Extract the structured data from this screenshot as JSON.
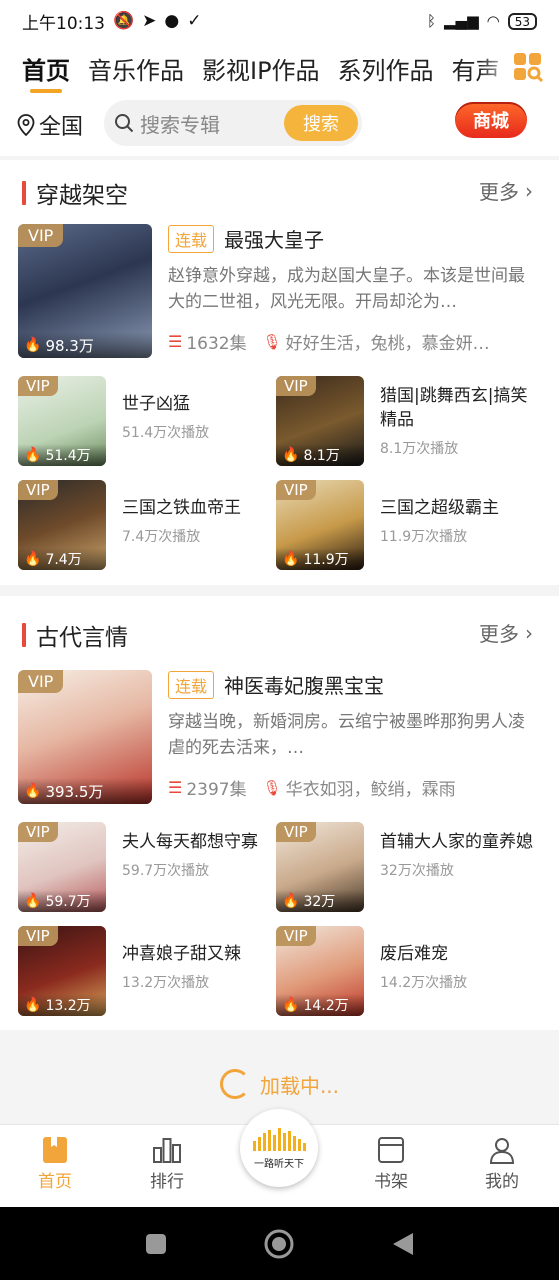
{
  "status_bar": {
    "time": "上午10:13",
    "battery": "53"
  },
  "tabs": [
    {
      "label": "首页",
      "active": true
    },
    {
      "label": "音乐作品"
    },
    {
      "label": "影视IP作品"
    },
    {
      "label": "系列作品"
    },
    {
      "label": "有声"
    }
  ],
  "search": {
    "location": "全国",
    "placeholder": "搜索专辑",
    "button": "搜索",
    "mall": "商城"
  },
  "sections": [
    {
      "title": "穿越架空",
      "more": "更多",
      "featured": {
        "vip": "VIP",
        "tag": "连载",
        "title": "最强大皇子",
        "desc": "赵铮意外穿越，成为赵国大皇子。本该是世间最大的二世祖，风光无限。开局却沦为…",
        "episodes": "1632集",
        "narrators": "好好生活，兔桃，慕金妍…",
        "plays": "98.3万"
      },
      "items": [
        {
          "vip": "VIP",
          "title": "世子凶猛",
          "sub": "51.4万次播放",
          "plays": "51.4万"
        },
        {
          "vip": "VIP",
          "title": "猎国|跳舞西玄|搞笑精品",
          "sub": "8.1万次播放",
          "plays": "8.1万"
        },
        {
          "vip": "VIP",
          "title": "三国之铁血帝王",
          "sub": "7.4万次播放",
          "plays": "7.4万"
        },
        {
          "vip": "VIP",
          "title": "三国之超级霸主",
          "sub": "11.9万次播放",
          "plays": "11.9万"
        }
      ]
    },
    {
      "title": "古代言情",
      "more": "更多",
      "featured": {
        "vip": "VIP",
        "tag": "连载",
        "title": "神医毒妃腹黑宝宝",
        "desc": "穿越当晚，新婚洞房。云绾宁被墨晔那狗男人凌虐的死去活来，…",
        "episodes": "2397集",
        "narrators": "华衣如羽，鲛绡，霖雨",
        "plays": "393.5万"
      },
      "items": [
        {
          "vip": "VIP",
          "title": "夫人每天都想守寡",
          "sub": "59.7万次播放",
          "plays": "59.7万"
        },
        {
          "vip": "VIP",
          "title": "首辅大人家的童养媳",
          "sub": "32万次播放",
          "plays": "32万"
        },
        {
          "vip": "VIP",
          "title": "冲喜娘子甜又辣",
          "sub": "13.2万次播放",
          "plays": "13.2万"
        },
        {
          "vip": "VIP",
          "title": "废后难宠",
          "sub": "14.2万次播放",
          "plays": "14.2万"
        }
      ]
    }
  ],
  "loading": "加载中...",
  "bottom_nav": [
    {
      "label": "首页",
      "active": true
    },
    {
      "label": "排行"
    },
    {
      "label": "书架"
    },
    {
      "label": "我的"
    }
  ],
  "center_logo_text": "一路听天下",
  "colors": {
    "accent": "#f2a53a",
    "red": "#e74a3b",
    "mall": "#e72a1d"
  }
}
